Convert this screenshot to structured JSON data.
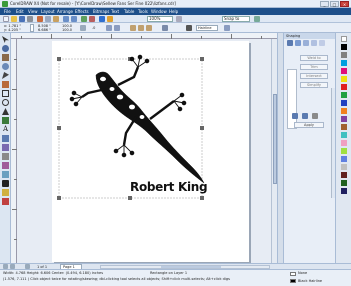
{
  "window": {
    "title": "CorelDRAW X4 (Not for resale) - [Y:\\CorelDraw\\Sellew Fans Ser Fine 022\\lizfans.cdr]",
    "minimize": "_",
    "maximize": "□",
    "close": "×"
  },
  "menu": [
    "File",
    "Edit",
    "View",
    "Layout",
    "Arrange",
    "Effects",
    "Bitmaps",
    "Text",
    "Table",
    "Tools",
    "Window",
    "Help"
  ],
  "toolbar": {
    "zoom": "100%",
    "snap": "Snap to"
  },
  "property_bar": {
    "x": "x: 1.781 \"",
    "y": "y: 4.205 \"",
    "w": "8.508 \"",
    "h": "6.686 \"",
    "sx": "100.0",
    "sy": "100.0",
    "angle": ".0",
    "outline": "Hairline"
  },
  "canvas": {
    "artist_name": "Robert King"
  },
  "docker": {
    "title": "Shaping",
    "buttons": [
      "Weld to",
      "Trim",
      "Intersect",
      "Simplify",
      "Front minus back",
      "Apply"
    ],
    "tab_label": "Object Properties"
  },
  "pagebar": {
    "counter": "1 of 1",
    "tab": "Page 1"
  },
  "status": {
    "line1": "Width: 4.768  Height: 6.606  Center: (0.494, 6.180) inches",
    "object": "Rectangle on Layer 1",
    "line2": "(1.576, 7.111 )   Click object twice for rotating/skewing; dbl-clicking tool selects all objects; Shift+click multi-selects; Alt+click digs",
    "fill": "None",
    "outline": "Black  Hairline"
  },
  "colors": {
    "menubar": "#1d4f8a",
    "chrome": "#e8eef7",
    "page": "#ffffff",
    "ink": "#111111"
  }
}
